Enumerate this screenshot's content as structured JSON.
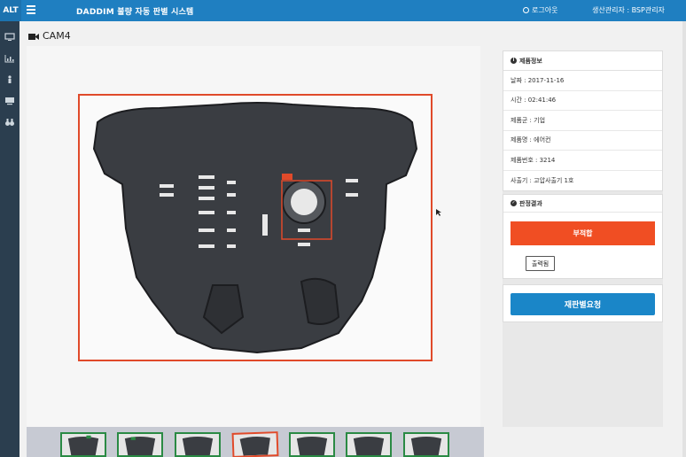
{
  "header": {
    "brand": "ALT",
    "title": "DADDIM 불량 자동 판별 시스템",
    "logout_label": "로그아웃",
    "user_label": "생산관리자 : BSP관리자"
  },
  "sidebar": {
    "items": [
      {
        "icon": "monitor-icon"
      },
      {
        "icon": "chart-icon"
      },
      {
        "icon": "person-icon"
      },
      {
        "icon": "desktop-icon"
      },
      {
        "icon": "binoculars-icon"
      }
    ]
  },
  "camera": {
    "label": "CAM4"
  },
  "product_info": {
    "heading": "제품정보",
    "rows": [
      "날짜 : 2017-11-16",
      "시간 : 02:41:46",
      "제품군 : 기업",
      "제품명 : 에어컨",
      "제품번호 : 3214",
      "사출기 : 고압사출기 1호"
    ]
  },
  "judgement": {
    "heading": "판정결과",
    "result": "부적합",
    "print_label": "출력됨"
  },
  "actions": {
    "rejudge_label": "재판별요청"
  },
  "colors": {
    "topbar": "#1f7fc1",
    "sidebar": "#2b3e4f",
    "defect": "#f04e23",
    "primary_button": "#1a86c8",
    "thumb_ok_border": "#2a8a44",
    "thumb_selected_border": "#e04a2a"
  },
  "thumbnails": {
    "count": 7,
    "selected_index": 3
  }
}
